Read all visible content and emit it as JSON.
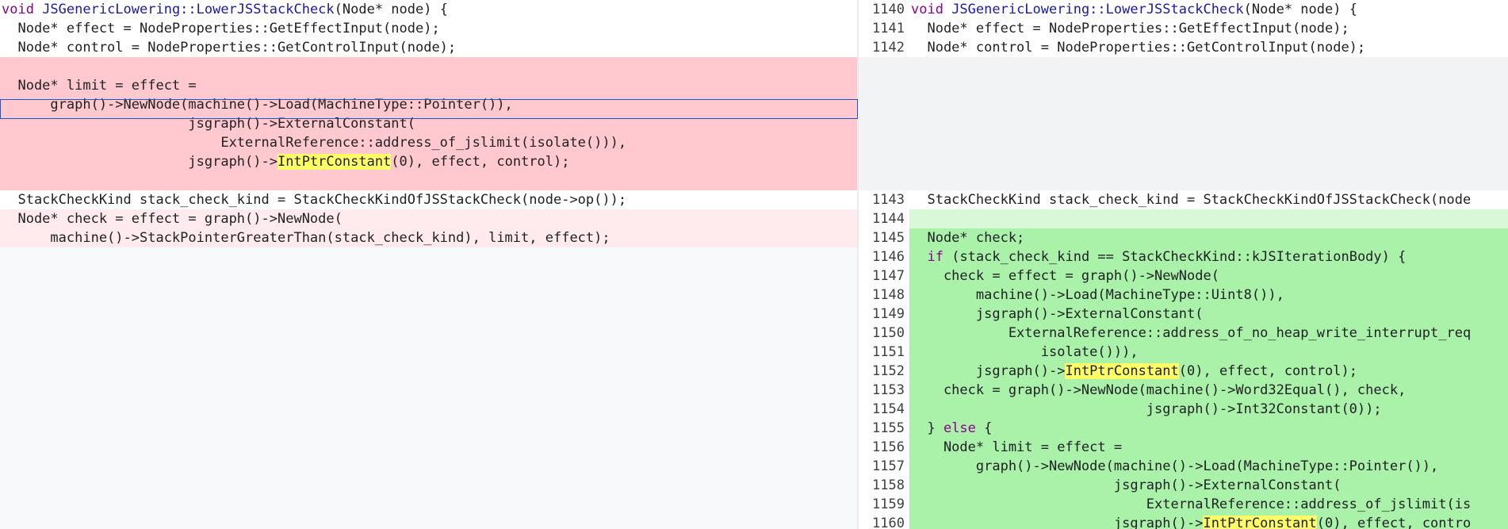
{
  "left": {
    "lines": [
      {
        "kind": "ctx",
        "parts": [
          {
            "t": "void ",
            "c": "kw"
          },
          {
            "t": "JSGenericLowering::LowerJSStackCheck",
            "c": "fn"
          },
          {
            "t": "(Node* node) {"
          }
        ]
      },
      {
        "kind": "ctx",
        "parts": [
          {
            "t": "  Node* effect = NodeProperties::GetEffectInput(node);"
          }
        ]
      },
      {
        "kind": "ctx",
        "parts": [
          {
            "t": "  Node* control = NodeProperties::GetControlInput(node);"
          }
        ]
      },
      {
        "kind": "del",
        "parts": [
          {
            "t": ""
          }
        ]
      },
      {
        "kind": "del",
        "parts": [
          {
            "t": "  Node* limit = effect ="
          }
        ]
      },
      {
        "kind": "del",
        "parts": [
          {
            "t": "      graph()->NewNode(machine()->Load(MachineType::Pointer()),"
          }
        ]
      },
      {
        "kind": "del",
        "parts": [
          {
            "t": "                       jsgraph()->ExternalConstant("
          }
        ]
      },
      {
        "kind": "del",
        "parts": [
          {
            "t": "                           ExternalReference::address_of_jslimit(isolate())),"
          }
        ]
      },
      {
        "kind": "del",
        "parts": [
          {
            "t": "                       jsgraph()->"
          },
          {
            "t": "IntPtrConstant",
            "c": "hl"
          },
          {
            "t": "(0), effect, control);"
          }
        ]
      },
      {
        "kind": "del",
        "parts": [
          {
            "t": ""
          }
        ]
      },
      {
        "kind": "ctx",
        "parts": [
          {
            "t": "  StackCheckKind stack_check_kind = StackCheckKindOfJSStackCheck(node->op());"
          }
        ]
      },
      {
        "kind": "dellite",
        "parts": [
          {
            "t": "  Node* check = effect = graph()->NewNode("
          }
        ]
      },
      {
        "kind": "dellite",
        "parts": [
          {
            "t": "      machine()->StackPointerGreaterThan(stack_check_kind), limit, effect);"
          }
        ]
      }
    ]
  },
  "right": {
    "lines": [
      {
        "no": "1140",
        "kind": "ctx",
        "parts": [
          {
            "t": "void ",
            "c": "kw"
          },
          {
            "t": "JSGenericLowering::LowerJSStackCheck",
            "c": "fn"
          },
          {
            "t": "(Node* node) {"
          }
        ]
      },
      {
        "no": "1141",
        "kind": "ctx",
        "parts": [
          {
            "t": "  Node* effect = NodeProperties::GetEffectInput(node);"
          }
        ]
      },
      {
        "no": "1142",
        "kind": "ctx",
        "parts": [
          {
            "t": "  Node* control = NodeProperties::GetControlInput(node);"
          }
        ]
      },
      {
        "no": "",
        "kind": "gray",
        "parts": [
          {
            "t": ""
          }
        ]
      },
      {
        "no": "",
        "kind": "gray",
        "parts": [
          {
            "t": ""
          }
        ]
      },
      {
        "no": "",
        "kind": "gray",
        "parts": [
          {
            "t": ""
          }
        ]
      },
      {
        "no": "",
        "kind": "gray",
        "parts": [
          {
            "t": ""
          }
        ]
      },
      {
        "no": "",
        "kind": "gray",
        "parts": [
          {
            "t": ""
          }
        ]
      },
      {
        "no": "",
        "kind": "gray",
        "parts": [
          {
            "t": ""
          }
        ]
      },
      {
        "no": "",
        "kind": "gray",
        "parts": [
          {
            "t": ""
          }
        ]
      },
      {
        "no": "1143",
        "kind": "ctx",
        "parts": [
          {
            "t": "  StackCheckKind stack_check_kind = StackCheckKindOfJSStackCheck(node"
          }
        ]
      },
      {
        "no": "1144",
        "kind": "add",
        "parts": [
          {
            "t": ""
          }
        ]
      },
      {
        "no": "1145",
        "kind": "addstrong",
        "parts": [
          {
            "t": "  Node* check;"
          }
        ]
      },
      {
        "no": "1146",
        "kind": "addstrong",
        "parts": [
          {
            "t": "  ",
            "c": ""
          },
          {
            "t": "if",
            "c": "kw"
          },
          {
            "t": " (stack_check_kind == StackCheckKind::kJSIterationBody) {"
          }
        ]
      },
      {
        "no": "1147",
        "kind": "addstrong",
        "parts": [
          {
            "t": "    check = effect = graph()->NewNode("
          }
        ]
      },
      {
        "no": "1148",
        "kind": "addstrong",
        "parts": [
          {
            "t": "        machine()->Load(MachineType::Uint8()),"
          }
        ]
      },
      {
        "no": "1149",
        "kind": "addstrong",
        "parts": [
          {
            "t": "        jsgraph()->ExternalConstant("
          }
        ]
      },
      {
        "no": "1150",
        "kind": "addstrong",
        "parts": [
          {
            "t": "            ExternalReference::address_of_no_heap_write_interrupt_req"
          }
        ]
      },
      {
        "no": "1151",
        "kind": "addstrong",
        "parts": [
          {
            "t": "                isolate())),"
          }
        ]
      },
      {
        "no": "1152",
        "kind": "addstrong",
        "parts": [
          {
            "t": "        jsgraph()->"
          },
          {
            "t": "IntPtrConstant",
            "c": "hl"
          },
          {
            "t": "(0), effect, control);"
          }
        ]
      },
      {
        "no": "1153",
        "kind": "addstrong",
        "parts": [
          {
            "t": "    check = graph()->NewNode(machine()->Word32Equal(), check,"
          }
        ]
      },
      {
        "no": "1154",
        "kind": "addstrong",
        "parts": [
          {
            "t": "                             jsgraph()->Int32Constant(0));"
          }
        ]
      },
      {
        "no": "1155",
        "kind": "addstrong",
        "parts": [
          {
            "t": "  } "
          },
          {
            "t": "else",
            "c": "kw"
          },
          {
            "t": " {"
          }
        ]
      },
      {
        "no": "1156",
        "kind": "addstrong",
        "parts": [
          {
            "t": "    Node* limit = effect ="
          }
        ]
      },
      {
        "no": "1157",
        "kind": "addstrong",
        "parts": [
          {
            "t": "        graph()->NewNode(machine()->Load(MachineType::Pointer()),"
          }
        ]
      },
      {
        "no": "1158",
        "kind": "addstrong",
        "parts": [
          {
            "t": "                         jsgraph()->ExternalConstant("
          }
        ]
      },
      {
        "no": "1159",
        "kind": "addstrong",
        "parts": [
          {
            "t": "                             ExternalReference::address_of_jslimit(is"
          }
        ]
      },
      {
        "no": "1160",
        "kind": "addstrong",
        "parts": [
          {
            "t": "                         jsgraph()->"
          },
          {
            "t": "IntPtrConstant",
            "c": "hl"
          },
          {
            "t": "(0), effect, contro"
          }
        ]
      }
    ]
  },
  "colors": {
    "del": "#ffc9cf",
    "add": "#aaf2aa",
    "highlight": "#ffff66",
    "keyword": "#8b008b",
    "function": "#1a1aa6"
  }
}
